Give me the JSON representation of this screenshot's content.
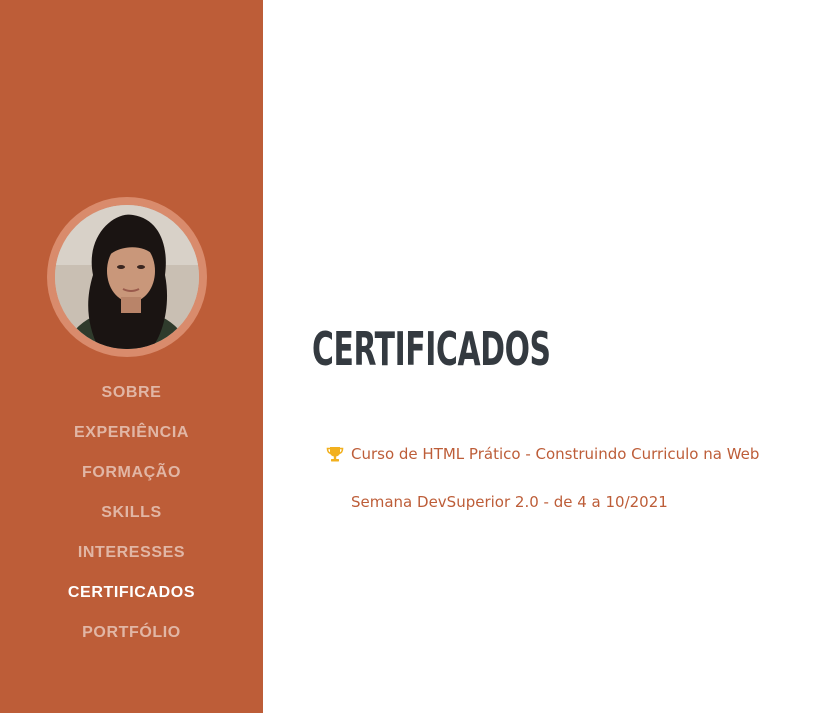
{
  "nav": {
    "items": [
      {
        "label": "SOBRE",
        "active": false
      },
      {
        "label": "EXPERIÊNCIA",
        "active": false
      },
      {
        "label": "FORMAÇÃO",
        "active": false
      },
      {
        "label": "SKILLS",
        "active": false
      },
      {
        "label": "INTERESSES",
        "active": false
      },
      {
        "label": "CERTIFICADOS",
        "active": true
      },
      {
        "label": "PORTFÓLIO",
        "active": false
      }
    ]
  },
  "main": {
    "title": "CERTIFICADOS",
    "certificates": [
      {
        "label": "Curso de HTML Prático - Construindo Curriculo na Web",
        "icon": "trophy-icon"
      },
      {
        "label": "Semana DevSuperior 2.0 - de 4 a 10/2021"
      }
    ]
  },
  "colors": {
    "sidebar": "#bd5d38",
    "accent": "#bd5d38",
    "title": "#343a40",
    "trophy": "#f2b01e"
  }
}
